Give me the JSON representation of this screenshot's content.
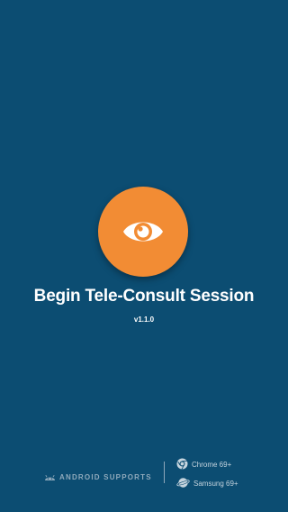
{
  "app": {
    "title": "Begin Tele-Consult Session",
    "version": "v1.1.0",
    "logo_icon": "eye-icon",
    "colors": {
      "background": "#0c4d72",
      "accent": "#f28c34",
      "text": "#ffffff"
    }
  },
  "footer": {
    "android_icon": "android-icon",
    "android_label": "ANDROID SUPPORTS",
    "browsers": [
      {
        "icon": "chrome-icon",
        "label": "Chrome 69+"
      },
      {
        "icon": "samsung-internet-icon",
        "label": "Samsung 69+"
      }
    ]
  }
}
